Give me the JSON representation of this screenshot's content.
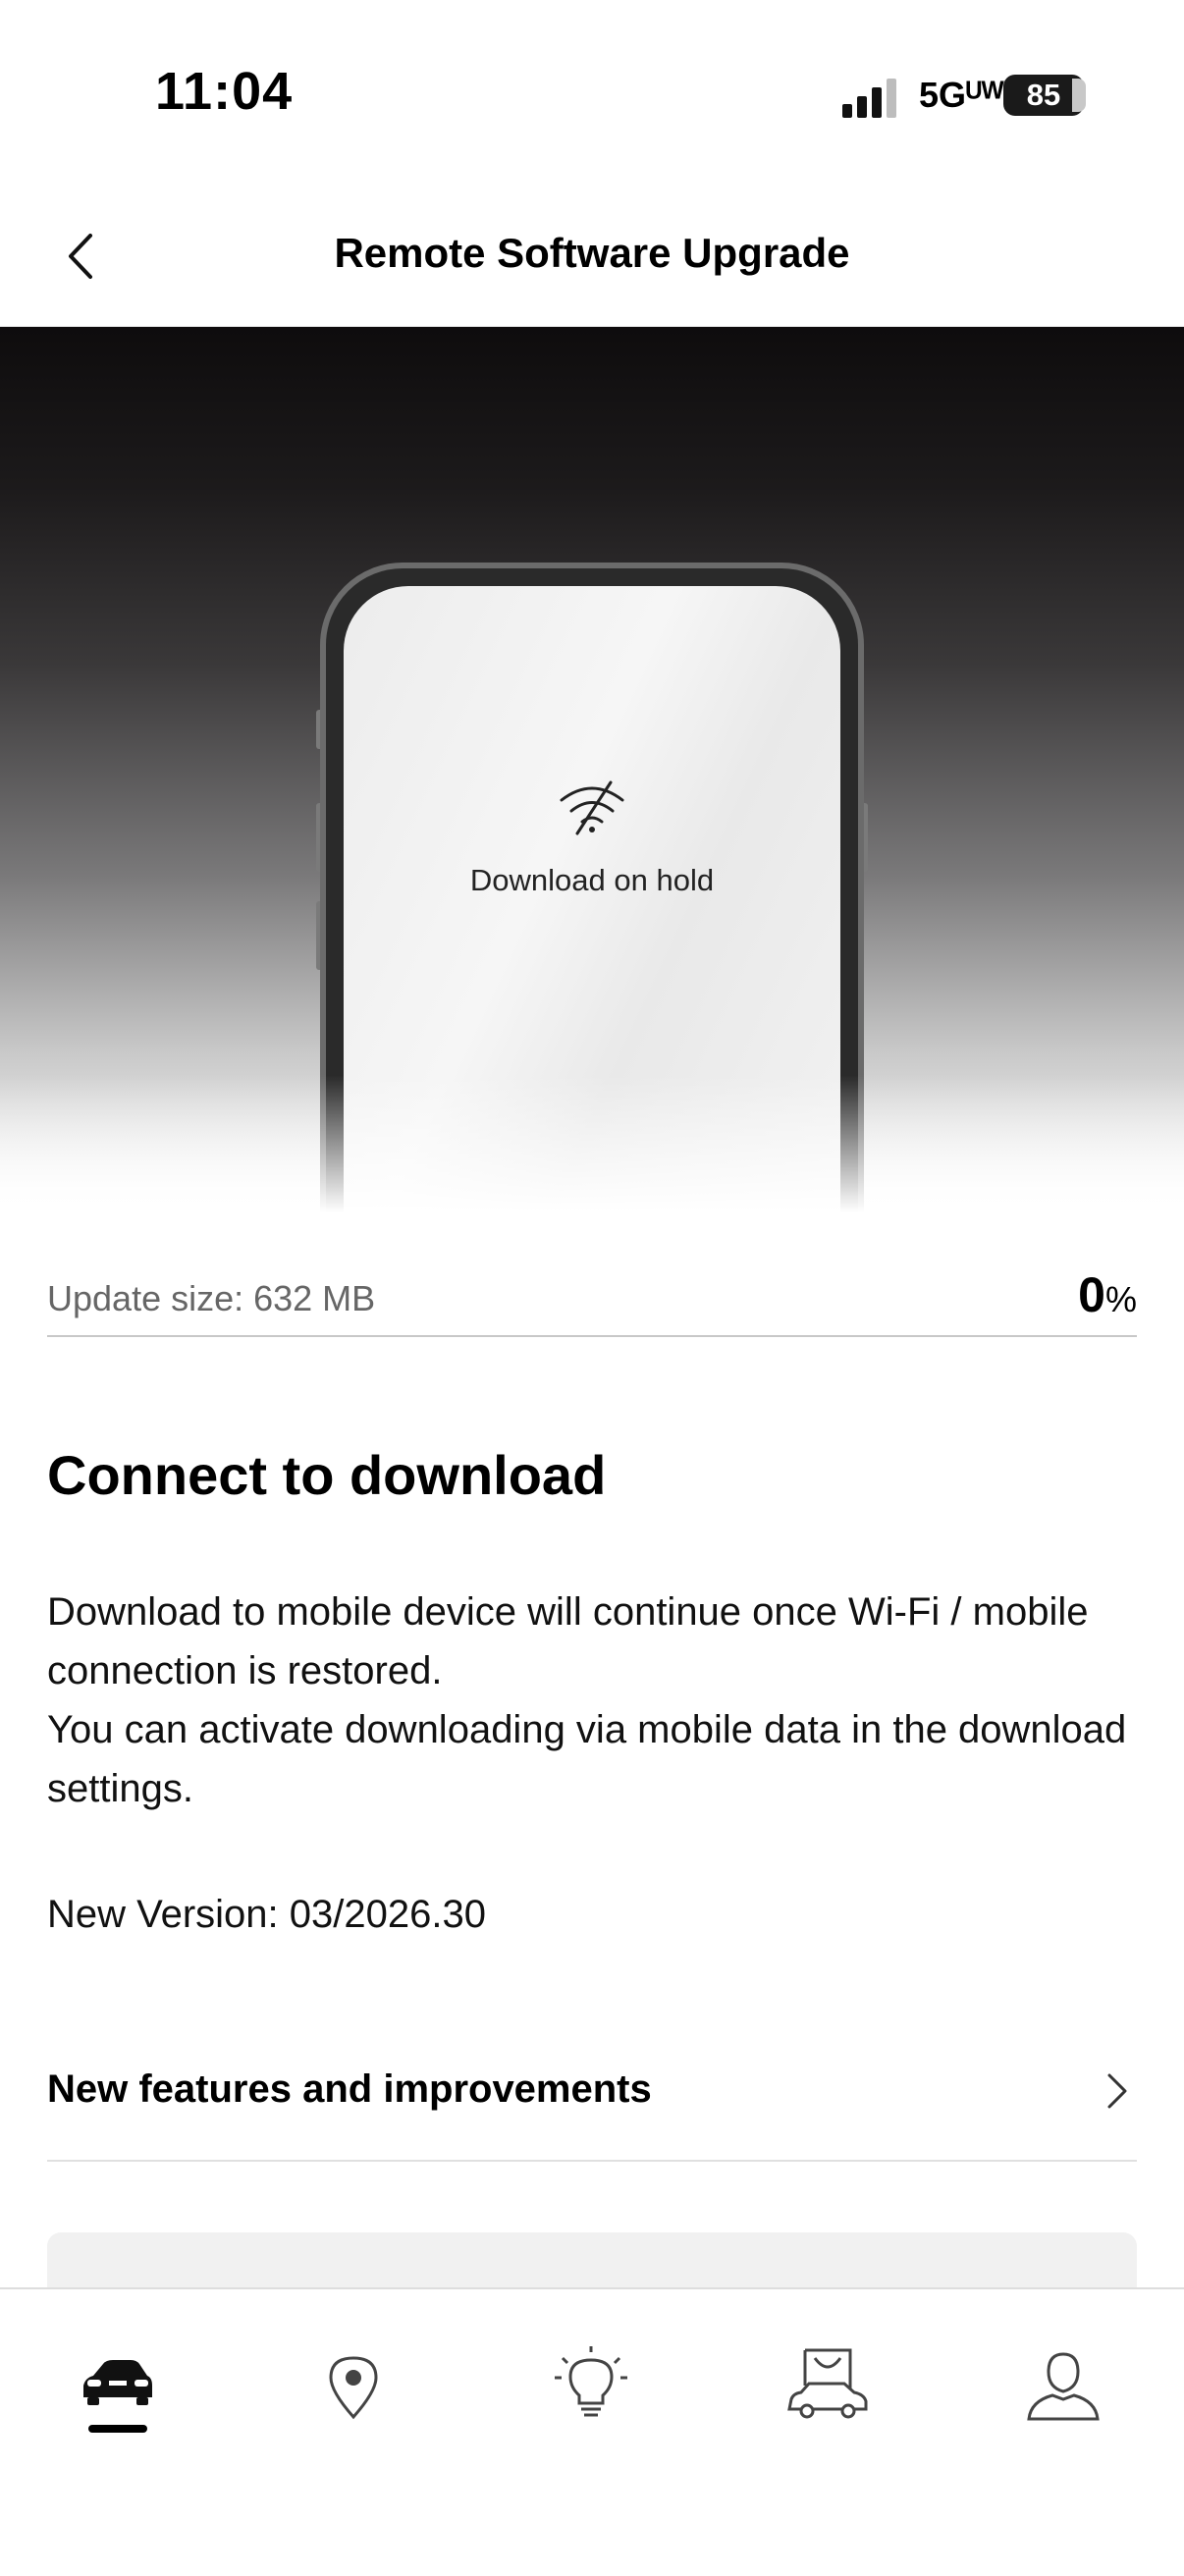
{
  "status": {
    "time": "11:04",
    "network": "5Gᵁᵂ",
    "battery": "85"
  },
  "header": {
    "title": "Remote Software Upgrade"
  },
  "hero": {
    "status_text": "Download on hold"
  },
  "update": {
    "size_label": "Update size: 632 MB",
    "percent_value": "0",
    "percent_sign": "%"
  },
  "content": {
    "heading": "Connect to download",
    "description_1": "Download to mobile device will continue once Wi-Fi / mobile connection is restored.",
    "description_2": "You can activate downloading via mobile data in the download settings.",
    "version": "New Version: 03/2026.30",
    "features_label": "New features and improvements"
  },
  "tabs": [
    {
      "icon": "car-icon",
      "active": true
    },
    {
      "icon": "location-pin-icon",
      "active": false
    },
    {
      "icon": "lightbulb-icon",
      "active": false
    },
    {
      "icon": "shop-car-icon",
      "active": false
    },
    {
      "icon": "profile-icon",
      "active": false
    }
  ]
}
